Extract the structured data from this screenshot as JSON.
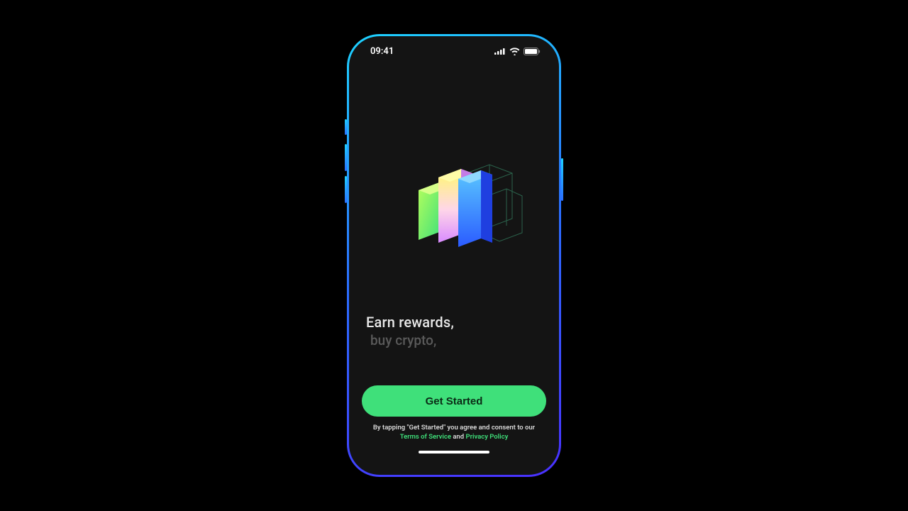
{
  "status": {
    "time": "09:41"
  },
  "hero": {
    "line1": "Earn rewards,",
    "line2": "buy crypto,"
  },
  "cta": {
    "label": "Get Started"
  },
  "legal": {
    "prefix": "By tapping \"Get Started\" you agree and consent to our",
    "tos": "Terms of Service",
    "and": "and",
    "privacy": "Privacy Policy"
  }
}
